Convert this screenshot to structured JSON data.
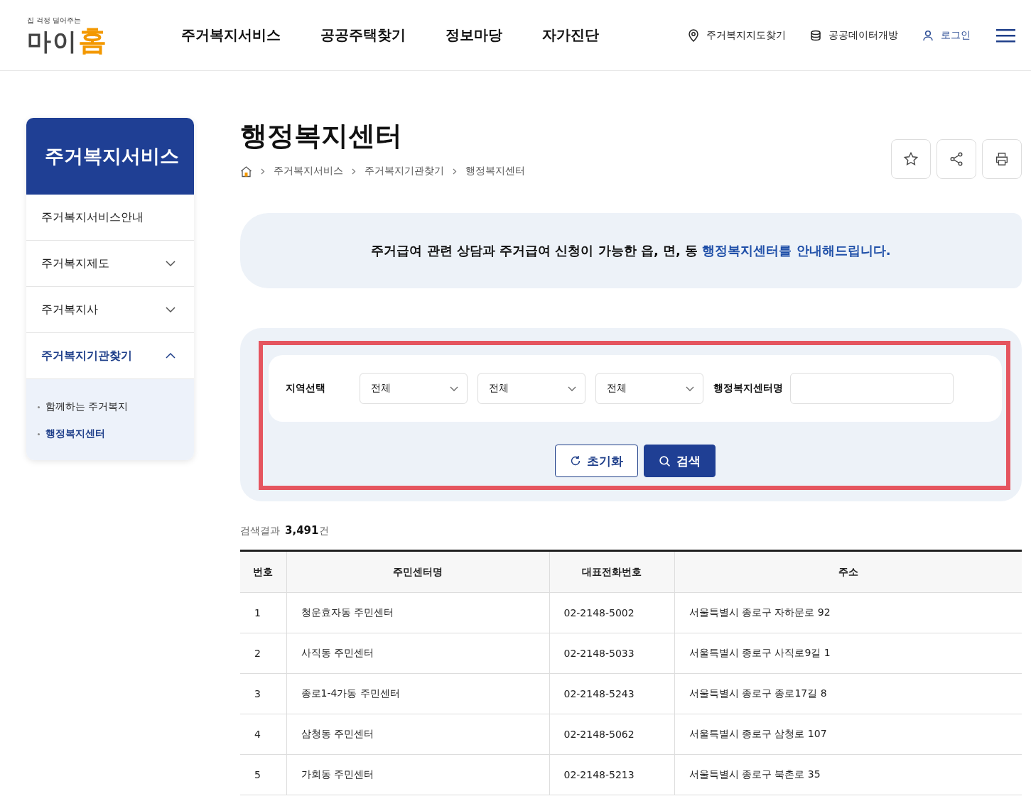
{
  "header": {
    "logo": {
      "tagline": "집 걱정 덜어주는",
      "name_main": "마이",
      "name_accent": "홈"
    },
    "nav": [
      "주거복지서비스",
      "공공주택찾기",
      "정보마당",
      "자가진단"
    ],
    "utility": [
      {
        "kind": "map",
        "label": "주거복지지도찾기"
      },
      {
        "kind": "data",
        "label": "공공데이터개방"
      },
      {
        "kind": "login",
        "label": "로그인"
      }
    ]
  },
  "sidebar": {
    "title": "주거복지서비스",
    "items": [
      {
        "label": "주거복지서비스안내",
        "kind": "link",
        "selected": false
      },
      {
        "label": "주거복지제도",
        "kind": "group",
        "selected": false,
        "expanded": false
      },
      {
        "label": "주거복지사",
        "kind": "group",
        "selected": false,
        "expanded": false
      },
      {
        "label": "주거복지기관찾기",
        "kind": "group",
        "selected": true,
        "expanded": true,
        "children": [
          {
            "label": "함께하는 주거복지",
            "selected": false
          },
          {
            "label": "행정복지센터",
            "selected": true
          }
        ]
      }
    ]
  },
  "page": {
    "title": "행정복지센터",
    "breadcrumb": [
      "주거복지서비스",
      "주거복지기관찾기",
      "행정복지센터"
    ]
  },
  "notice": {
    "text": "주거급여 관련 상담과 주거급여 신청이 가능한 읍, 면, 동 ",
    "highlight": "행정복지센터를 안내해드립니다."
  },
  "search": {
    "region_label": "지역선택",
    "selects": [
      "전체",
      "전체",
      "전체"
    ],
    "name_label": "행정복지센터명",
    "reset_button": "초기화",
    "search_button": "검색"
  },
  "result": {
    "label": "검색결과",
    "count": "3,491",
    "unit": "건"
  },
  "table": {
    "columns": [
      "번호",
      "주민센터명",
      "대표전화번호",
      "주소"
    ],
    "rows": [
      [
        "1",
        "청운효자동 주민센터",
        "02-2148-5002",
        "서울특별시 종로구 자하문로 92"
      ],
      [
        "2",
        "사직동 주민센터",
        "02-2148-5033",
        "서울특별시 종로구 사직로9길 1"
      ],
      [
        "3",
        "종로1-4가동 주민센터",
        "02-2148-5243",
        "서울특별시 종로구 종로17길 8"
      ],
      [
        "4",
        "삼청동 주민센터",
        "02-2148-5062",
        "서울특별시 종로구 삼청로 107"
      ],
      [
        "5",
        "가회동 주민센터",
        "02-2148-5213",
        "서울특별시 종로구 북촌로 35"
      ]
    ]
  }
}
